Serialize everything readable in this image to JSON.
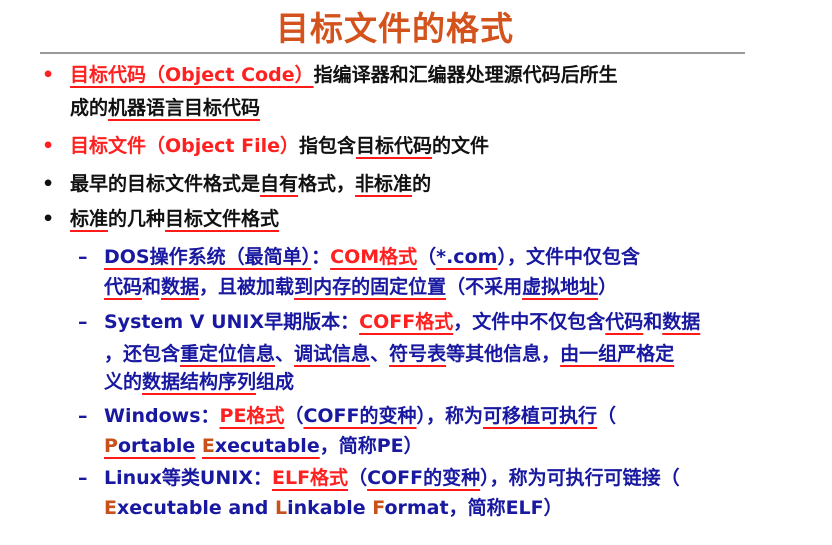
{
  "slide": {
    "title": "目标文件的格式",
    "colors": {
      "title": "#d4521c",
      "red": "#ff2020",
      "black": "#111111",
      "blue": "#1818a0",
      "orange": "#c8501a",
      "annotation": "#ff1a1a"
    },
    "items": [
      {
        "marker": "•",
        "level": 1,
        "lines": [
          [
            {
              "t": "目标代码（Object Code）",
              "c": "red",
              "u": true
            },
            {
              "t": "指编译器和汇编器处理源代码后所生",
              "c": "black"
            }
          ],
          [
            {
              "t": "成的",
              "c": "black"
            },
            {
              "t": "机器语言目标代码",
              "c": "black",
              "u": true
            }
          ]
        ]
      },
      {
        "marker": "•",
        "level": 1,
        "lines": [
          [
            {
              "t": "目标文件（Object File）",
              "c": "red"
            },
            {
              "t": "指包含",
              "c": "black"
            },
            {
              "t": "目标代码",
              "c": "black",
              "u": true
            },
            {
              "t": "的文件",
              "c": "black"
            }
          ]
        ]
      },
      {
        "marker": "•",
        "level": 1,
        "lines": [
          [
            {
              "t": "最早的目标文件格式是",
              "c": "black"
            },
            {
              "t": "自有",
              "c": "black",
              "u": true
            },
            {
              "t": "格式，",
              "c": "black"
            },
            {
              "t": "非标准",
              "c": "black",
              "u": true
            },
            {
              "t": "的",
              "c": "black"
            }
          ]
        ]
      },
      {
        "marker": "•",
        "level": 1,
        "lines": [
          [
            {
              "t": "标准",
              "c": "black",
              "u": true
            },
            {
              "t": "的几种",
              "c": "black"
            },
            {
              "t": "目标文件格式",
              "c": "black",
              "u": true
            }
          ]
        ]
      },
      {
        "marker": "–",
        "level": 2,
        "lines": [
          [
            {
              "t": "DOS操作系统（最简单）",
              "c": "blue",
              "u": true
            },
            {
              "t": "：",
              "c": "blue"
            },
            {
              "t": "COM格式",
              "c": "red",
              "u": true
            },
            {
              "t": "（",
              "c": "blue"
            },
            {
              "t": "*.com",
              "c": "blue",
              "u": true
            },
            {
              "t": "），文件中仅包含",
              "c": "blue"
            }
          ],
          [
            {
              "t": "代码",
              "c": "blue",
              "u": true
            },
            {
              "t": "和",
              "c": "blue"
            },
            {
              "t": "数据",
              "c": "blue",
              "u": true
            },
            {
              "t": "，且被加载",
              "c": "blue"
            },
            {
              "t": "到内存的固定位置",
              "c": "blue",
              "u": true
            },
            {
              "t": "（不采用",
              "c": "blue"
            },
            {
              "t": "虚拟地址",
              "c": "blue",
              "u": true
            },
            {
              "t": "）",
              "c": "blue"
            }
          ]
        ]
      },
      {
        "marker": "–",
        "level": 2,
        "lines": [
          [
            {
              "t": "System V UNIX早期版本：",
              "c": "blue"
            },
            {
              "t": "COFF格式",
              "c": "red",
              "u": true
            },
            {
              "t": "，文件中不仅包含",
              "c": "blue"
            },
            {
              "t": "代码",
              "c": "blue",
              "u": true
            },
            {
              "t": "和",
              "c": "blue"
            },
            {
              "t": "数据",
              "c": "blue",
              "u": true
            }
          ],
          [
            {
              "t": "，还包含",
              "c": "blue"
            },
            {
              "t": "重定位信息",
              "c": "blue",
              "u": true
            },
            {
              "t": "、",
              "c": "blue"
            },
            {
              "t": "调试信息",
              "c": "blue",
              "u": true
            },
            {
              "t": "、",
              "c": "blue"
            },
            {
              "t": "符号表",
              "c": "blue",
              "u": true
            },
            {
              "t": "等其他信息，",
              "c": "blue"
            },
            {
              "t": "由一组严格定",
              "c": "blue",
              "u": true
            }
          ],
          [
            {
              "t": "义的",
              "c": "blue"
            },
            {
              "t": "数据结构序列",
              "c": "blue",
              "u": true
            },
            {
              "t": "组成",
              "c": "blue"
            }
          ]
        ]
      },
      {
        "marker": "–",
        "level": 2,
        "lines": [
          [
            {
              "t": "Windows：",
              "c": "blue"
            },
            {
              "t": "PE格式",
              "c": "red",
              "u": true
            },
            {
              "t": "（",
              "c": "blue"
            },
            {
              "t": "COFF的变种",
              "c": "blue",
              "u": true
            },
            {
              "t": "），称为",
              "c": "blue"
            },
            {
              "t": "可移植可执行",
              "c": "blue",
              "u": true
            },
            {
              "t": "（",
              "c": "blue"
            }
          ],
          [
            {
              "t": "P",
              "c": "orange",
              "u": true
            },
            {
              "t": "ortable",
              "c": "blue",
              "u": true
            },
            {
              "t": " ",
              "c": "blue"
            },
            {
              "t": "E",
              "c": "orange",
              "u": true
            },
            {
              "t": "xecutable",
              "c": "blue",
              "u": true
            },
            {
              "t": "，简称PE）",
              "c": "blue"
            }
          ]
        ]
      },
      {
        "marker": "–",
        "level": 2,
        "lines": [
          [
            {
              "t": "Linux等类UNIX：",
              "c": "blue"
            },
            {
              "t": "ELF格式",
              "c": "red",
              "u": true
            },
            {
              "t": "（",
              "c": "blue"
            },
            {
              "t": "COFF的变种",
              "c": "blue",
              "u": true
            },
            {
              "t": "），称为可执行可链接（",
              "c": "blue"
            }
          ],
          [
            {
              "t": "E",
              "c": "orange"
            },
            {
              "t": "xecutable and ",
              "c": "blue"
            },
            {
              "t": "L",
              "c": "orange"
            },
            {
              "t": "inkable ",
              "c": "blue"
            },
            {
              "t": "F",
              "c": "orange"
            },
            {
              "t": "ormat，简称ELF）",
              "c": "blue"
            }
          ]
        ]
      }
    ]
  }
}
